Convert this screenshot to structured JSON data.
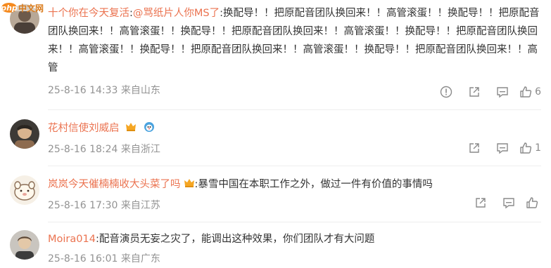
{
  "watermark": {
    "php": "php",
    "site": "中文网"
  },
  "comments": [
    {
      "username": "十个你在今天复活",
      "mention": "@骂纸片人你MS了",
      "text": "换配导！！把原配音团队换回来！！高管滚蛋！！换配导！！把原配音团队换回来！！高管滚蛋！！换配导！！把原配音团队换回来！！高管滚蛋！！换配导！！把原配音团队换回来！！高管滚蛋！！换配导！！把原配音团队换回来！！高管滚蛋！！换配导！！把原配音团队换回来！！高管",
      "date": "25-8-16 14:33",
      "location": "来自山东",
      "likes": "6"
    },
    {
      "username": "花村信使刘威启",
      "text": "",
      "date": "25-8-16 18:24",
      "location": "来自浙江",
      "likes": "1"
    },
    {
      "username": "岚岚今天催楠楠收大头菜了吗",
      "text": ":暴雪中国在本职工作之外，做过一件有价值的事情吗",
      "date": "25-8-16 17:30",
      "location": "来自江苏",
      "likes": ""
    },
    {
      "username": "Moira014",
      "text": ":配音演员无妄之灾了，能调出这种效果，你们团队才有大问题",
      "date": "25-8-16 16:01",
      "location": "来自广东",
      "likes": ""
    }
  ],
  "colors": {
    "username": "#eb7350",
    "meta": "#939393",
    "icon": "#8a8a8a"
  }
}
